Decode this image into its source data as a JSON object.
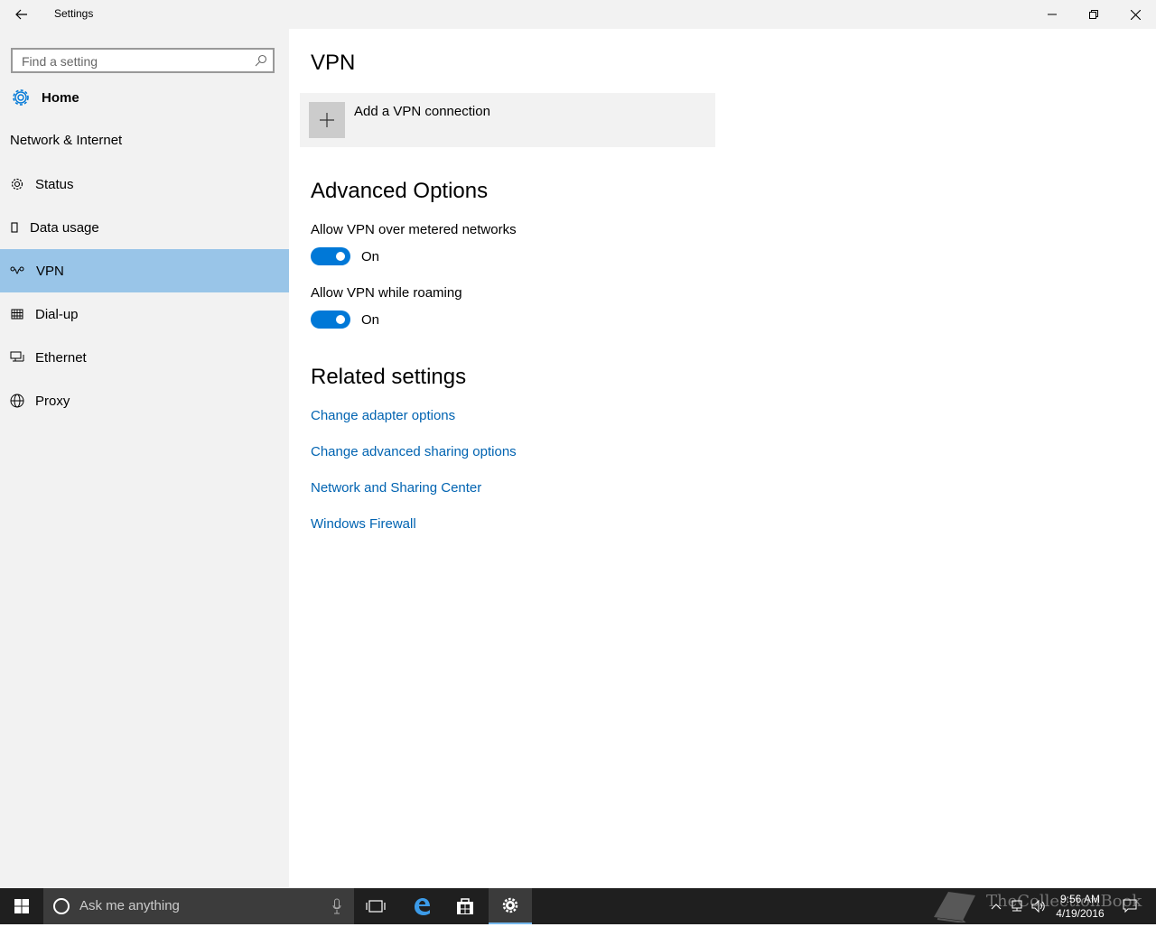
{
  "window": {
    "title": "Settings"
  },
  "sidebar": {
    "search_placeholder": "Find a setting",
    "home_label": "Home",
    "section_title": "Network & Internet",
    "items": [
      {
        "label": "Status",
        "icon": "gear-icon"
      },
      {
        "label": "Data usage",
        "icon": "data-usage-icon"
      },
      {
        "label": "VPN",
        "icon": "vpn-icon",
        "selected": true
      },
      {
        "label": "Dial-up",
        "icon": "dialup-icon"
      },
      {
        "label": "Ethernet",
        "icon": "ethernet-icon"
      },
      {
        "label": "Proxy",
        "icon": "globe-icon"
      }
    ]
  },
  "main": {
    "title": "VPN",
    "add_vpn_label": "Add a VPN connection",
    "advanced_title": "Advanced Options",
    "options": [
      {
        "label": "Allow VPN over metered networks",
        "state": "On"
      },
      {
        "label": "Allow VPN while roaming",
        "state": "On"
      }
    ],
    "related_title": "Related settings",
    "related_links": [
      "Change adapter options",
      "Change advanced sharing options",
      "Network and Sharing Center",
      "Windows Firewall"
    ]
  },
  "taskbar": {
    "search_text": "Ask me anything",
    "time": "9:56 AM",
    "date": "4/19/2016",
    "watermark": "TheCollectionBook"
  },
  "colors": {
    "accent": "#0078d7",
    "selected_bg": "#99c5e8",
    "link": "#0063b1",
    "sidebar_bg": "#f2f2f2",
    "taskbar_bg": "#1f1f1f"
  }
}
